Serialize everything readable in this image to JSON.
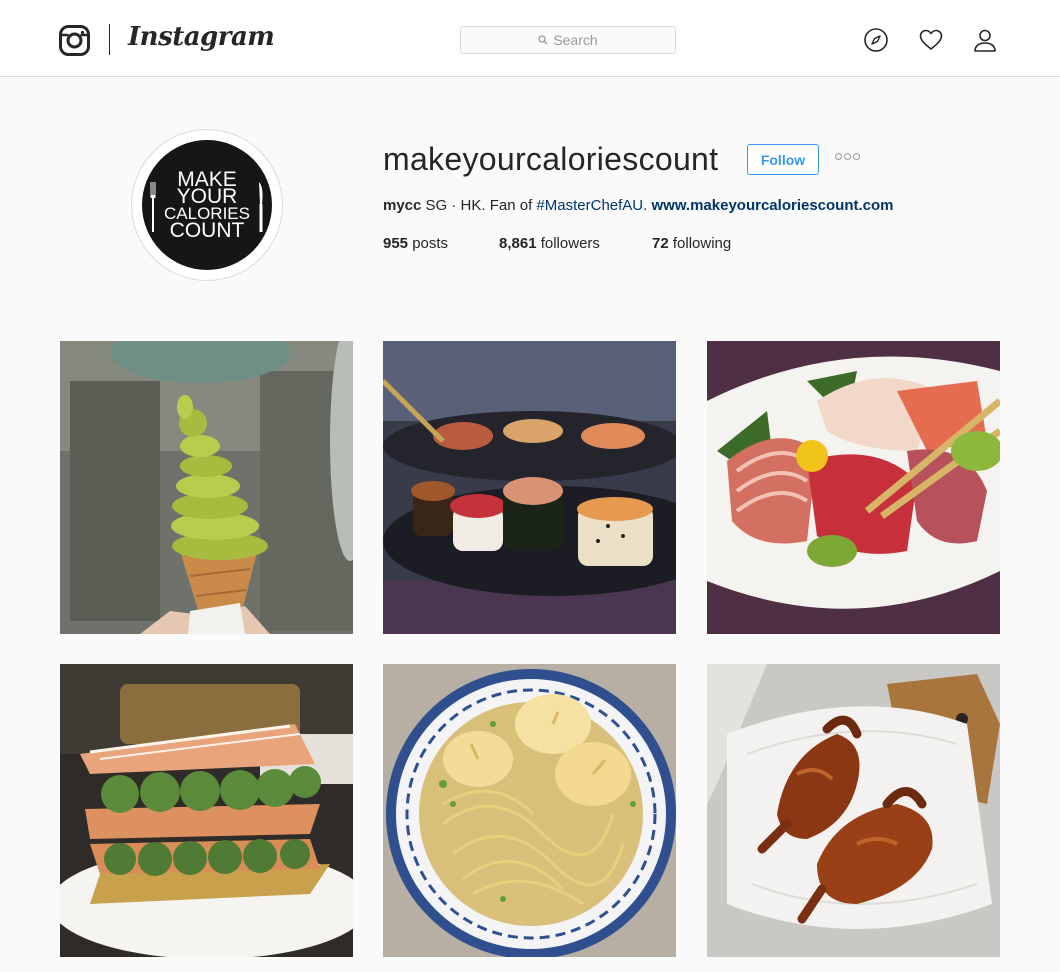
{
  "app": {
    "wordmark": "Instagram"
  },
  "search": {
    "placeholder": "Search"
  },
  "nav_icons": [
    "compass-icon",
    "heart-icon",
    "person-icon"
  ],
  "profile": {
    "username": "makeyourcaloriescount",
    "follow_label": "Follow",
    "avatar_text": [
      "MAKE",
      "YOUR",
      "CALORIES",
      "COUNT"
    ],
    "bio": {
      "name": "mycc",
      "text": " SG · HK. Fan of ",
      "hashtag": "#MasterChefAU",
      "separator": ". ",
      "link": "www.makeyourcaloriescount.com"
    },
    "stats": {
      "posts_value": "955",
      "posts_label": " posts",
      "followers_value": "8,861",
      "followers_label": " followers",
      "following_value": "72",
      "following_label": " following"
    }
  },
  "colors": {
    "accent": "#3897f0",
    "link": "#003569",
    "border": "#dbdbdb",
    "background": "#fafafa"
  },
  "posts": [
    {
      "subject": "matcha-soft-serve-cone"
    },
    {
      "subject": "sushi-platter"
    },
    {
      "subject": "sashimi-platter"
    },
    {
      "subject": "matcha-mille-feuille"
    },
    {
      "subject": "wonton-noodle-soup"
    },
    {
      "subject": "roast-pigeon"
    }
  ]
}
